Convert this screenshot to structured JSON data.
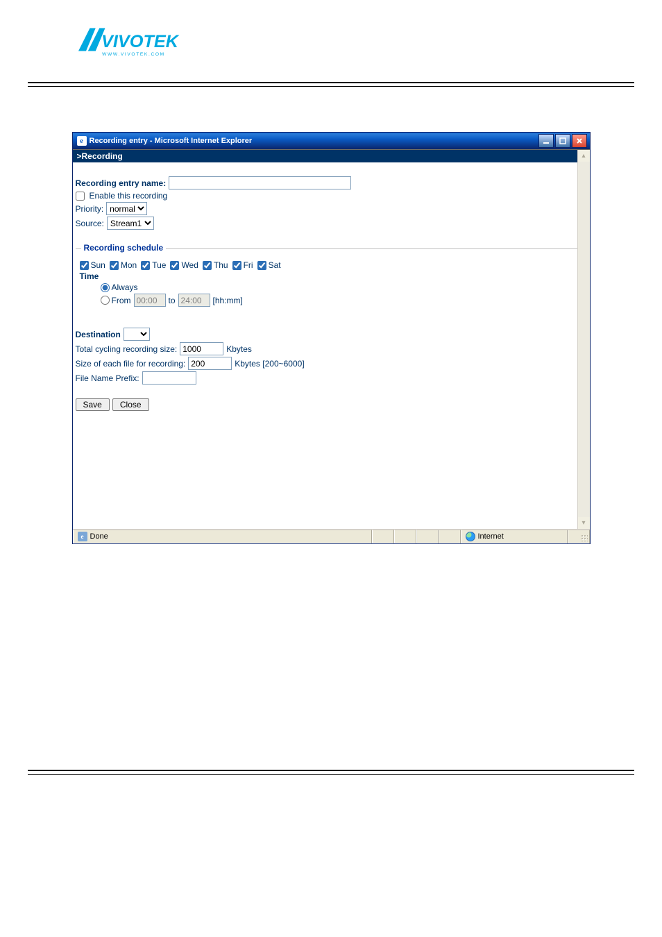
{
  "window": {
    "title": "Recording entry - Microsoft Internet Explorer"
  },
  "header": {
    "text": ">Recording"
  },
  "form": {
    "entry_name_label": "Recording entry name:",
    "entry_name_value": "",
    "enable_label": "Enable this recording",
    "enable_checked": false,
    "priority_label": "Priority:",
    "priority_value": "normal",
    "source_label": "Source:",
    "source_value": "Stream1"
  },
  "schedule": {
    "legend": "Recording schedule",
    "days": {
      "sun": {
        "label": "Sun",
        "checked": true
      },
      "mon": {
        "label": "Mon",
        "checked": true
      },
      "tue": {
        "label": "Tue",
        "checked": true
      },
      "wed": {
        "label": "Wed",
        "checked": true
      },
      "thu": {
        "label": "Thu",
        "checked": true
      },
      "fri": {
        "label": "Fri",
        "checked": true
      },
      "sat": {
        "label": "Sat",
        "checked": true
      }
    },
    "time_label": "Time",
    "always_label": "Always",
    "always_selected": true,
    "from_label": "From",
    "from_value": "00:00",
    "to_label": "to",
    "to_value": "24:00",
    "hhmm_label": "[hh:mm]"
  },
  "dest": {
    "label": "Destination",
    "value": "",
    "total_label": "Total cycling recording size:",
    "total_value": "1000",
    "total_unit": "Kbytes",
    "each_label": "Size of each file for recording:",
    "each_value": "200",
    "each_unit": "Kbytes [200~6000]",
    "prefix_label": "File Name Prefix:",
    "prefix_value": ""
  },
  "buttons": {
    "save": "Save",
    "close": "Close"
  },
  "status": {
    "done": "Done",
    "zone": "Internet"
  }
}
